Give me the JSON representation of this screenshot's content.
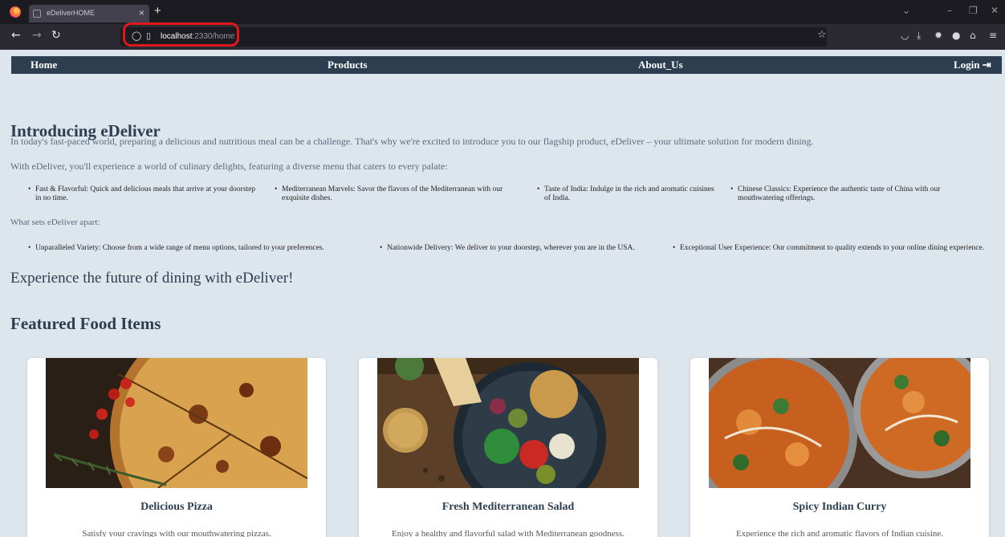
{
  "browser": {
    "tab_title": "eDeliverHOME",
    "tab_close": "×",
    "new_tab": "+",
    "url_host": "localhost",
    "url_rest": ":2330/home",
    "annotation_color": "#e0171c"
  },
  "site_nav": {
    "items": [
      {
        "label": "Home"
      },
      {
        "label": "Products"
      },
      {
        "label": "About_Us"
      }
    ],
    "login_label": "Login",
    "login_icon": "login-arrow-icon"
  },
  "intro": {
    "title": "Introducing eDeliver",
    "paragraph1": "In today's fast-paced world, preparing a delicious and nutritious meal can be a challenge. That's why we're excited to introduce you to our flagship product, eDeliver – your ultimate solution for modern dining.",
    "paragraph2": "With eDeliver, you'll experience a world of culinary delights, featuring a diverse menu that caters to every palate:",
    "features": [
      {
        "text": "Fast & Flavorful: Quick and delicious meals that arrive at your doorstep in no time."
      },
      {
        "text": "Mediterranean Marvels: Savor the flavors of the Mediterranean with our exquisite dishes."
      },
      {
        "text": "Taste of India: Indulge in the rich and aromatic cuisines of India."
      },
      {
        "text": "Chinese Classics: Experience the authentic taste of China with our mouthwatering offerings."
      }
    ],
    "apart_heading": "What sets eDeliver apart:",
    "apart_points": [
      {
        "text": "Unparalleled Variety: Choose from a wide range of menu options, tailored to your preferences."
      },
      {
        "text": "Nationwide Delivery: We deliver to your doorstep, wherever you are in the USA."
      },
      {
        "text": "Exceptional User Experience: Our commitment to quality extends to your online dining experience."
      }
    ],
    "tagline": "Experience the future of dining with eDeliver!"
  },
  "featured": {
    "heading": "Featured Food Items",
    "items": [
      {
        "title": "Delicious Pizza",
        "description": "Satisfy your cravings with our mouthwatering pizzas."
      },
      {
        "title": "Fresh Mediterranean Salad",
        "description": "Enjoy a healthy and flavorful salad with Mediterranean goodness."
      },
      {
        "title": "Spicy Indian Curry",
        "description": "Experience the rich and aromatic flavors of Indian cuisine."
      }
    ]
  },
  "colors": {
    "page_bg": "#dde6ed",
    "nav_bg": "#2c3e50",
    "heading": "#2c3e50"
  }
}
